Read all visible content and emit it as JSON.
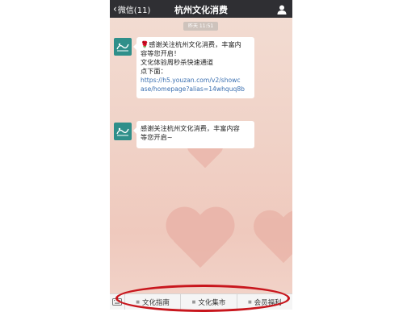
{
  "header": {
    "back_label": "微信(11)",
    "title": "杭州文化消费"
  },
  "chat": {
    "timestamp": "昨天 11:51",
    "messages": [
      {
        "lines": [
          "🌹感谢关注杭州文化消费，丰富内",
          "容等您开启！",
          "文化体验周秒杀快速通道",
          "点下面："
        ],
        "link_lines": [
          "https://h5.youzan.com/v2/showc",
          "ase/homepage?alias=14whquq8b"
        ]
      },
      {
        "lines": [
          "感谢关注杭州文化消费，丰富内容",
          "等您开启~"
        ]
      }
    ]
  },
  "menu": {
    "items": [
      "文化指南",
      "文化集市",
      "会员福利"
    ]
  },
  "colors": {
    "header_bg": "#2f2f33",
    "annotation": "#c8161d",
    "link": "#3a6fb0",
    "avatar": "#2f8f8a"
  }
}
